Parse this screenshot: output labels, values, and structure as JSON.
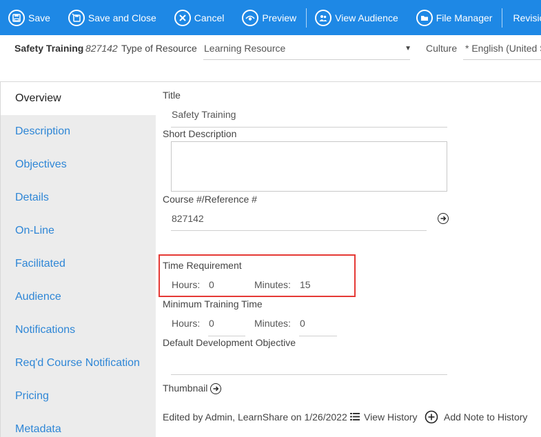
{
  "toolbar": {
    "save": "Save",
    "save_close": "Save and Close",
    "cancel": "Cancel",
    "preview": "Preview",
    "view_audience": "View Audience",
    "file_manager": "File Manager",
    "revision": "Revision C"
  },
  "header": {
    "title": "Safety Training",
    "number": "827142",
    "type_label": "Type of Resource",
    "type_value": "Learning Resource",
    "culture_label": "Culture",
    "culture_value": "* English (United S"
  },
  "sidebar": {
    "items": [
      {
        "label": "Overview"
      },
      {
        "label": "Description"
      },
      {
        "label": "Objectives"
      },
      {
        "label": "Details"
      },
      {
        "label": "On-Line"
      },
      {
        "label": "Facilitated"
      },
      {
        "label": "Audience"
      },
      {
        "label": "Notifications"
      },
      {
        "label": "Req'd Course Notification"
      },
      {
        "label": "Pricing"
      },
      {
        "label": "Metadata"
      }
    ]
  },
  "form": {
    "title_label": "Title",
    "title_value": "Safety Training",
    "short_desc_label": "Short Description",
    "short_desc_value": "",
    "course_ref_label": "Course #/Reference #",
    "course_ref_value": "827142",
    "time_req_label": "Time Requirement",
    "time_req_hours_label": "Hours:",
    "time_req_hours": "0",
    "time_req_minutes_label": "Minutes:",
    "time_req_minutes": "15",
    "min_time_label": "Minimum Training Time",
    "min_hours_label": "Hours:",
    "min_hours": "0",
    "min_minutes_label": "Minutes:",
    "min_minutes": "0",
    "dev_objective_label": "Default Development Objective",
    "dev_objective_value": "",
    "thumbnail_label": "Thumbnail"
  },
  "footer": {
    "edited_by": "Edited by Admin, LearnShare on 1/26/2022",
    "view_history": "View History",
    "add_note": "Add Note to History"
  },
  "colors": {
    "toolbar_bg": "#1e88e5",
    "link": "#2e86d6",
    "highlight": "#e53935"
  }
}
